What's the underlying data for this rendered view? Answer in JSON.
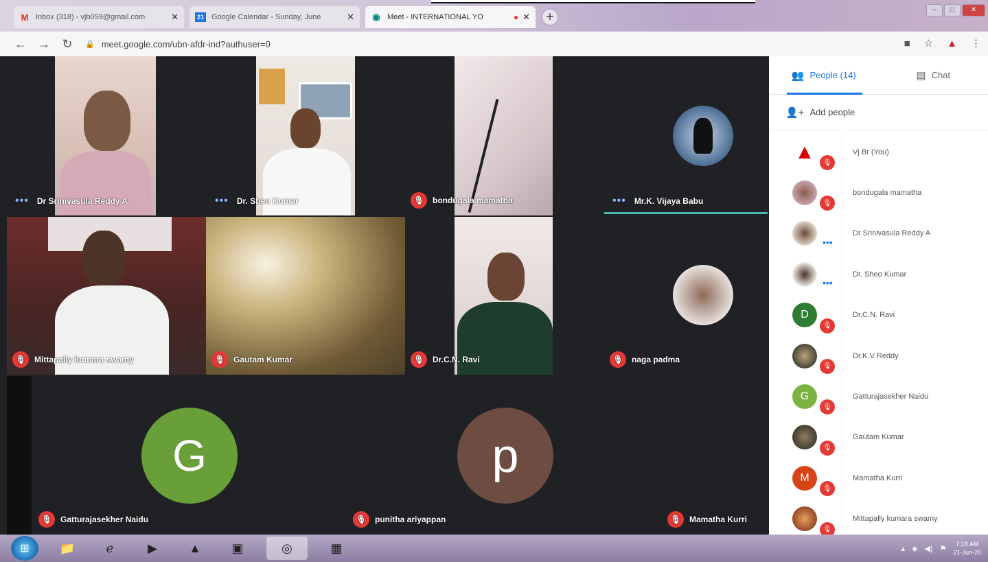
{
  "browser": {
    "tabs": [
      {
        "title": "Inbox (318) - vjb059@gmail.com",
        "icon": "gmail-icon",
        "active": false
      },
      {
        "title": "Google Calendar - Sunday, June",
        "icon": "calendar-icon",
        "active": false
      },
      {
        "title": "Meet - INTERNATIONAL YO",
        "icon": "meet-icon",
        "active": true
      }
    ],
    "url": "meet.google.com/ubn-afdr-ind?authuser=0"
  },
  "meet": {
    "tiles": [
      {
        "name": "Dr Srinivasula Reddy A",
        "status": "speaking-dots"
      },
      {
        "name": "Dr. Sheo Kumar",
        "status": "speaking-dots"
      },
      {
        "name": "bondugala mamatha",
        "status": "muted"
      },
      {
        "name": "Mr.K. Vijaya Babu",
        "status": "speaking-dots"
      },
      {
        "name": "Mittapally kumara swamy",
        "status": "muted"
      },
      {
        "name": "Gautam Kumar",
        "status": "muted"
      },
      {
        "name": "Dr.C.N. Ravi",
        "status": "muted"
      },
      {
        "name": "naga padma",
        "status": "muted"
      },
      {
        "name": "Gatturajasekher Naidu",
        "status": "muted",
        "initial": "G",
        "color": "#689f38"
      },
      {
        "name": "punitha ariyappan",
        "status": "muted",
        "initial": "p",
        "color": "#6d4c41"
      },
      {
        "name": "Mamatha Kurri",
        "status": "muted"
      }
    ]
  },
  "panel": {
    "people_tab": "People (14)",
    "chat_tab": "Chat",
    "add_people": "Add people",
    "people": [
      {
        "name": "Vj Br (You)",
        "avatar": "blood-drop",
        "status": "muted"
      },
      {
        "name": "bondugala mamatha",
        "avatar": "photo",
        "status": "muted"
      },
      {
        "name": "Dr Srinivasula Reddy A",
        "avatar": "photo",
        "status": "dots"
      },
      {
        "name": "Dr. Sheo Kumar",
        "avatar": "photo",
        "status": "dots"
      },
      {
        "name": "Dr.C.N. Ravi",
        "avatar": "initial",
        "initial": "D",
        "color": "#2e7d32",
        "status": "muted"
      },
      {
        "name": "Dr.K.V Reddy",
        "avatar": "photo",
        "status": "muted"
      },
      {
        "name": "Gatturajasekher Naidu",
        "avatar": "initial",
        "initial": "G",
        "color": "#7cb342",
        "status": "muted"
      },
      {
        "name": "Gautam Kumar",
        "avatar": "photo",
        "status": "muted"
      },
      {
        "name": "Mamatha Kurri",
        "avatar": "initial",
        "initial": "M",
        "color": "#d84315",
        "status": "muted"
      },
      {
        "name": "Mittapally kumara swamy",
        "avatar": "photo",
        "status": "muted"
      }
    ]
  },
  "taskbar": {
    "time": "7:18 AM",
    "date": "21-Jun-20"
  }
}
